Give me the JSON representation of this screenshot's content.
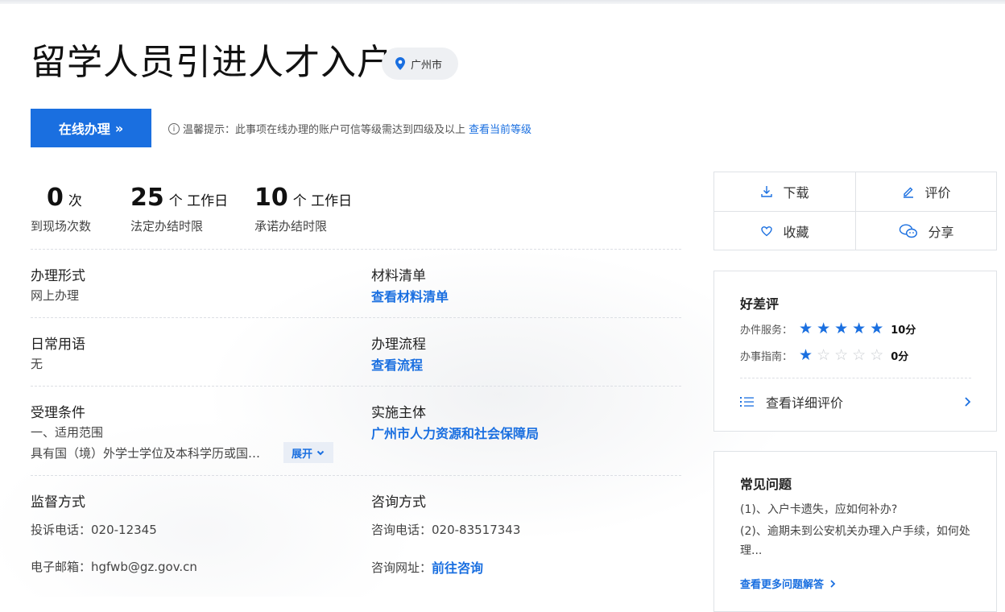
{
  "page": {
    "title": "留学人员引进人才入户",
    "city": "广州市"
  },
  "apply": {
    "button_label": "在线办理",
    "button_chevron": "»",
    "tip_text": "温馨提示：此事项在线办理的账户可信等级需达到四级及以上",
    "tip_link": "查看当前等级",
    "tip_icon": "i"
  },
  "stats": [
    {
      "num": "0",
      "unit": "次",
      "label": "到现场次数"
    },
    {
      "num": "25",
      "unit": "个 工作日",
      "label": "法定办结时限"
    },
    {
      "num": "10",
      "unit": "个 工作日",
      "label": "承诺办结时限"
    }
  ],
  "fields": {
    "form": {
      "title": "办理形式",
      "value": "网上办理"
    },
    "materials": {
      "title": "材料清单",
      "link": "查看材料清单"
    },
    "terms": {
      "title": "日常用语",
      "value": "无"
    },
    "process": {
      "title": "办理流程",
      "link": "查看流程"
    },
    "conditions": {
      "title": "受理条件",
      "line1": "一、适用范围",
      "line2": "具有国（境）外学士学位及本科学历或国…",
      "expand": "展开"
    },
    "agency": {
      "title": "实施主体",
      "link": "广州市人力资源和社会保障局"
    },
    "supervision": {
      "title": "监督方式",
      "phone": "投诉电话：020-12345",
      "email": "电子邮箱：hgfwb@gz.gov.cn"
    },
    "consult": {
      "title": "咨询方式",
      "phone": "咨询电话：020-83517343",
      "site_label": "咨询网址：",
      "site_link": "前往咨询"
    }
  },
  "actions": {
    "download": "下载",
    "rate": "评价",
    "favorite": "收藏",
    "share": "分享"
  },
  "rating": {
    "title": "好差评",
    "rows": [
      {
        "label": "办件服务：",
        "stars": 5,
        "score": "10分"
      },
      {
        "label": "办事指南：",
        "stars": 1,
        "score": "0分"
      }
    ],
    "max_stars": 5,
    "detail": "查看详细评价",
    "star_color": "#1a6fe0"
  },
  "faq": {
    "title": "常见问题",
    "items": [
      "(1)、入户卡遗失，应如何补办?",
      "(2)、逾期未到公安机关办理入户手续，如何处理..."
    ],
    "more": "查看更多问题解答"
  }
}
